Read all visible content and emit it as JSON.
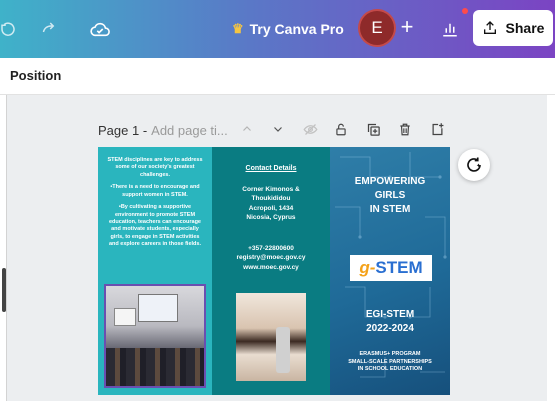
{
  "topbar": {
    "try_pro_label": "Try Canva Pro",
    "avatar_letter": "E",
    "share_label": "Share",
    "colors": {
      "gradient_start": "#3fb2c9",
      "gradient_end": "#7b44c3",
      "avatar": "#8e2a2a"
    }
  },
  "position_panel": {
    "label": "Position"
  },
  "page_header": {
    "page_label": "Page 1 -",
    "title_placeholder": "Add page ti...",
    "icons": [
      "chevron-up-icon",
      "chevron-down-icon",
      "hide-icon",
      "lock-icon",
      "duplicate-icon",
      "delete-icon",
      "add-page-icon"
    ]
  },
  "brochure": {
    "panel1": {
      "paragraphs": [
        "STEM disciplines are key to address some of our society's greatest challenges.",
        "•There is a need to encourage and support women in STEM.",
        "•By cultivating a supportive environment to promote STEM education, teachers can encourage and motivate students, especially girls, to engage in STEM activities and explore careers in those fields."
      ]
    },
    "panel2": {
      "heading": "Contact Details",
      "address_lines": [
        "Corner Kimonos &",
        "Thoukididou",
        "Acropoli, 1434",
        "Nicosia, Cyprus"
      ],
      "contact_lines": [
        "+357-22800600",
        "registry@moec.gov.cy",
        "www.moec.gov.cy"
      ]
    },
    "panel3": {
      "heading_lines": [
        "EMPOWERING",
        "GIRLS",
        "IN STEM"
      ],
      "logo_prefix": "g",
      "logo_dash": "-",
      "logo_stem": "STEM",
      "project_lines": [
        "EGI-STEM",
        "2022-2024"
      ],
      "program_lines": [
        "ERASMUS+ PROGRAM",
        "SMALL-SCALE PARTNERSHIPS",
        "IN SCHOOL EDUCATION"
      ]
    }
  }
}
